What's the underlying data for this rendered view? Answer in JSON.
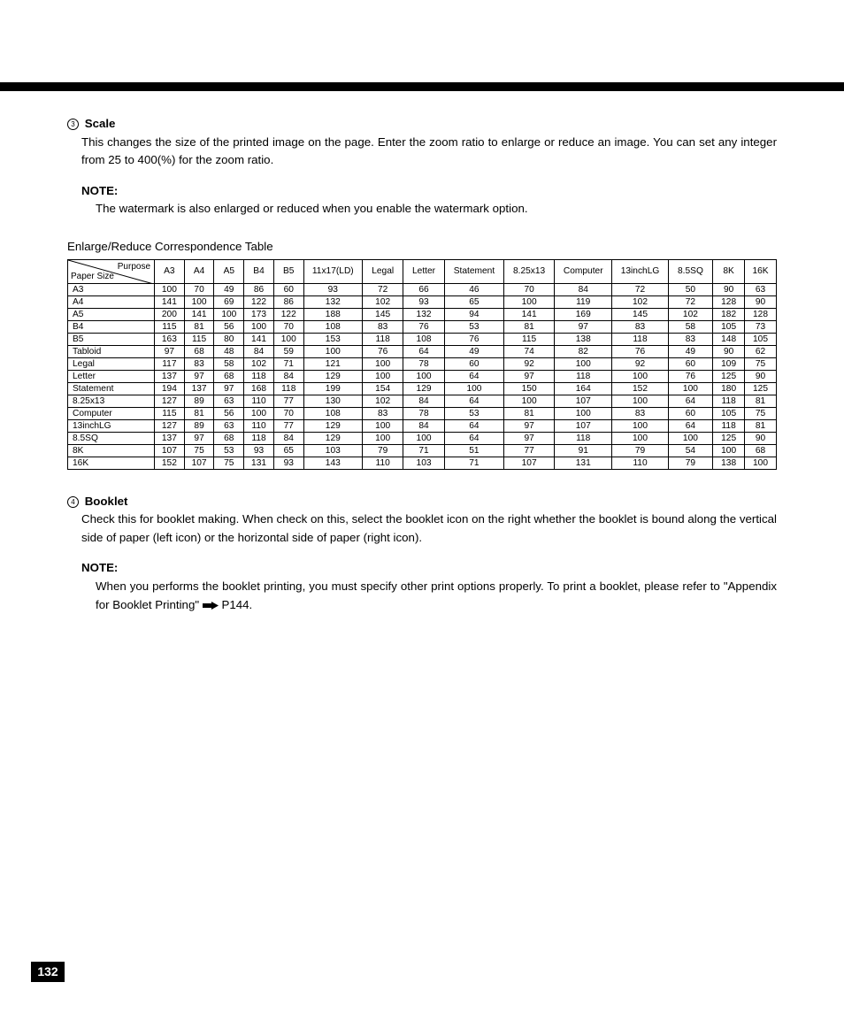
{
  "page_number": "132",
  "section_scale": {
    "num": "3",
    "title": "Scale",
    "body": "This changes the size of the printed image on the page.  Enter the zoom ratio to enlarge or reduce an image.  You can set any integer from 25 to 400(%) for the zoom ratio.",
    "note_label": "NOTE:",
    "note_body": "The watermark is also enlarged or reduced when you enable the watermark option."
  },
  "table_caption": "Enlarge/Reduce Correspondence Table",
  "diag_purpose": "Purpose",
  "diag_papersize": "Paper Size",
  "chart_data": {
    "type": "table",
    "columns": [
      "A3",
      "A4",
      "A5",
      "B4",
      "B5",
      "11x17(LD)",
      "Legal",
      "Letter",
      "Statement",
      "8.25x13",
      "Computer",
      "13inchLG",
      "8.5SQ",
      "8K",
      "16K"
    ],
    "rows": [
      {
        "label": "A3",
        "values": [
          100,
          70,
          49,
          86,
          60,
          93,
          72,
          66,
          46,
          70,
          84,
          72,
          50,
          90,
          63
        ]
      },
      {
        "label": "A4",
        "values": [
          141,
          100,
          69,
          122,
          86,
          132,
          102,
          93,
          65,
          100,
          119,
          102,
          72,
          128,
          90
        ]
      },
      {
        "label": "A5",
        "values": [
          200,
          141,
          100,
          173,
          122,
          188,
          145,
          132,
          94,
          141,
          169,
          145,
          102,
          182,
          128
        ]
      },
      {
        "label": "B4",
        "values": [
          115,
          81,
          56,
          100,
          70,
          108,
          83,
          76,
          53,
          81,
          97,
          83,
          58,
          105,
          73
        ]
      },
      {
        "label": "B5",
        "values": [
          163,
          115,
          80,
          141,
          100,
          153,
          118,
          108,
          76,
          115,
          138,
          118,
          83,
          148,
          105
        ]
      },
      {
        "label": "Tabloid",
        "values": [
          97,
          68,
          48,
          84,
          59,
          100,
          76,
          64,
          49,
          74,
          82,
          76,
          49,
          90,
          62
        ]
      },
      {
        "label": "Legal",
        "values": [
          117,
          83,
          58,
          102,
          71,
          121,
          100,
          78,
          60,
          92,
          100,
          92,
          60,
          109,
          75
        ]
      },
      {
        "label": "Letter",
        "values": [
          137,
          97,
          68,
          118,
          84,
          129,
          100,
          100,
          64,
          97,
          118,
          100,
          76,
          125,
          90
        ]
      },
      {
        "label": "Statement",
        "values": [
          194,
          137,
          97,
          168,
          118,
          199,
          154,
          129,
          100,
          150,
          164,
          152,
          100,
          180,
          125
        ]
      },
      {
        "label": "8.25x13",
        "values": [
          127,
          89,
          63,
          110,
          77,
          130,
          102,
          84,
          64,
          100,
          107,
          100,
          64,
          118,
          81
        ]
      },
      {
        "label": "Computer",
        "values": [
          115,
          81,
          56,
          100,
          70,
          108,
          83,
          78,
          53,
          81,
          100,
          83,
          60,
          105,
          75
        ]
      },
      {
        "label": "13inchLG",
        "values": [
          127,
          89,
          63,
          110,
          77,
          129,
          100,
          84,
          64,
          97,
          107,
          100,
          64,
          118,
          81
        ]
      },
      {
        "label": "8.5SQ",
        "values": [
          137,
          97,
          68,
          118,
          84,
          129,
          100,
          100,
          64,
          97,
          118,
          100,
          100,
          125,
          90
        ]
      },
      {
        "label": "8K",
        "values": [
          107,
          75,
          53,
          93,
          65,
          103,
          79,
          71,
          51,
          77,
          91,
          79,
          54,
          100,
          68
        ]
      },
      {
        "label": "16K",
        "values": [
          152,
          107,
          75,
          131,
          93,
          143,
          110,
          103,
          71,
          107,
          131,
          110,
          79,
          138,
          100
        ]
      }
    ]
  },
  "section_booklet": {
    "num": "4",
    "title": "Booklet",
    "body": "Check this for booklet making.  When check on this, select the booklet icon on the right whether the booklet is bound along the vertical side of paper (left icon) or the horizontal side of paper (right icon).",
    "note_label": "NOTE:",
    "note_body_1": "When you performs the booklet printing, you must specify other print options properly.  To print a booklet, please refer to \"Appendix for Booklet Printing\" ",
    "note_body_2": " P144."
  }
}
